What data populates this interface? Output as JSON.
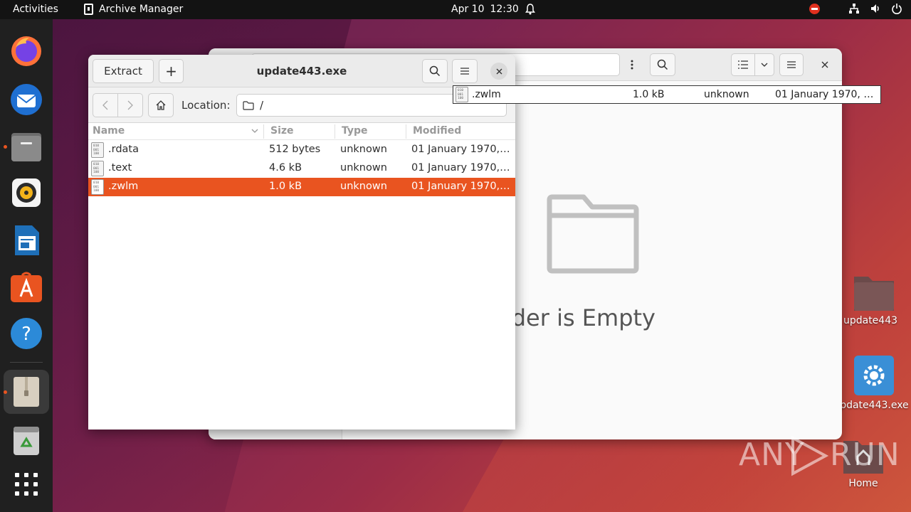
{
  "topbar": {
    "activities": "Activities",
    "app_name": "Archive Manager",
    "date": "Apr 10",
    "time": "12:30"
  },
  "dock": {
    "items": [
      "firefox-icon",
      "thunderbird-icon",
      "files-icon",
      "rhythmbox-icon",
      "writer-icon",
      "app-center-icon",
      "help-icon",
      "archive-manager-icon",
      "trash-icon",
      "show-apps-icon"
    ]
  },
  "desktop": {
    "icons": [
      {
        "label": "update443"
      },
      {
        "label": "update443.exe"
      },
      {
        "label": "Home"
      }
    ]
  },
  "files_window": {
    "empty_text": "Folder is Empty"
  },
  "tooltip_row": {
    "name": ".zwlm",
    "size": "1.0 kB",
    "type": "unknown",
    "modified": "01 January 1970, …"
  },
  "archive": {
    "title": "update443.exe",
    "extract_label": "Extract",
    "add_label": "+",
    "location_label": "Location:",
    "location_value": "/",
    "columns": {
      "name": "Name",
      "size": "Size",
      "type": "Type",
      "modified": "Modified"
    },
    "rows": [
      {
        "name": ".rdata",
        "size": "512 bytes",
        "type": "unknown",
        "modified": "01 January 1970,…",
        "selected": false
      },
      {
        "name": ".text",
        "size": "4.6 kB",
        "type": "unknown",
        "modified": "01 January 1970,…",
        "selected": false
      },
      {
        "name": ".zwlm",
        "size": "1.0 kB",
        "type": "unknown",
        "modified": "01 January 1970,…",
        "selected": true
      }
    ],
    "binary_icon_text": "010\n001\n100"
  },
  "watermark": {
    "left": "ANY",
    "right": "RUN"
  },
  "colors": {
    "accent": "#e95420",
    "topbar": "#131313",
    "dock": "#202020"
  }
}
